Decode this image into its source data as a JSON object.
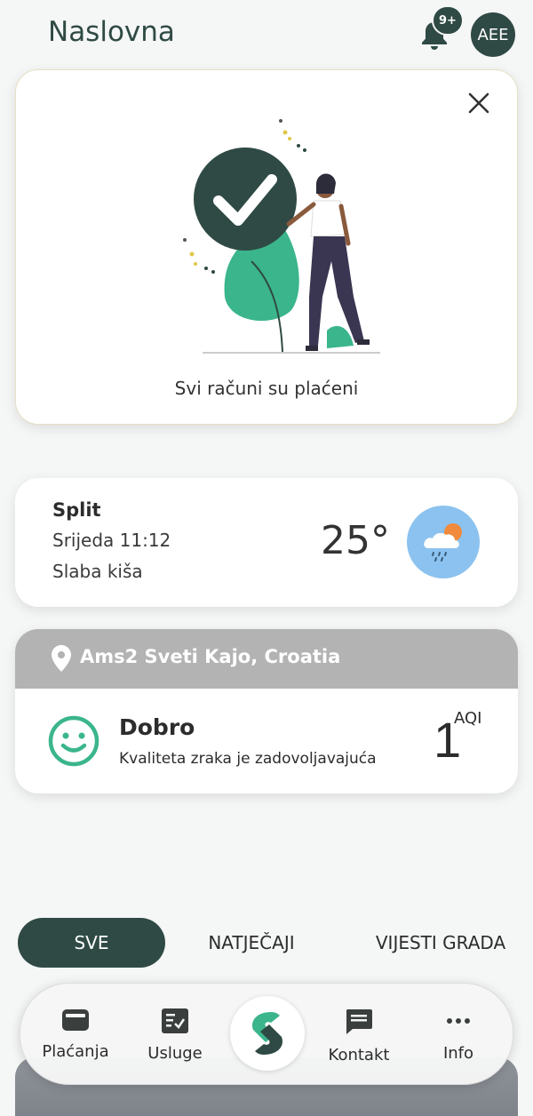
{
  "header": {
    "title": "Naslovna",
    "notification_badge": "9+",
    "avatar_initials": "AEE"
  },
  "payments_card": {
    "message": "Svi računi su plaćeni",
    "close_icon": "close-icon",
    "illustration": "woman-with-checkmark-illustration"
  },
  "weather": {
    "city": "Split",
    "datetime": "Srijeda 11:12",
    "description": "Slaba kiša",
    "temperature": "25°",
    "icon": "rain-cloud-sun-icon",
    "icon_bg": "#8bc2ef"
  },
  "air_quality": {
    "location": "Ams2 Sveti Kajo, Croatia",
    "status": "Dobro",
    "description": "Kvaliteta zraka je zadovoljavajuća",
    "value": "1",
    "unit": "AQI",
    "status_color": "#3bb58c"
  },
  "filter_tabs": [
    {
      "label": "SVE",
      "active": true
    },
    {
      "label": "NATJEČAJI",
      "active": false
    },
    {
      "label": "VIJESTI GRADA",
      "active": false
    }
  ],
  "bottom_nav": [
    {
      "label": "Plaćanja",
      "icon": "wallet-icon"
    },
    {
      "label": "Usluge",
      "icon": "checklist-icon"
    },
    {
      "label": "",
      "icon": "app-logo-icon"
    },
    {
      "label": "Kontakt",
      "icon": "chat-icon"
    },
    {
      "label": "Info",
      "icon": "more-dots-icon"
    }
  ],
  "colors": {
    "primary": "#2f4a44",
    "accent_green": "#3bb58c",
    "location_bar": "#b3b3b3"
  }
}
